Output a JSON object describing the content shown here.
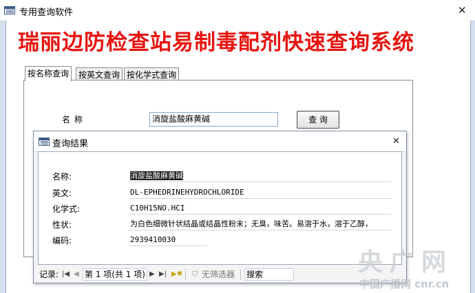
{
  "main_window": {
    "title": "专用查询软件",
    "close": "✕"
  },
  "banner": {
    "title": "瑞丽边防检查站易制毒配剂快速查询系统"
  },
  "tabs": [
    {
      "label": "按名称查询",
      "active": true
    },
    {
      "label": "按英文查询",
      "active": false
    },
    {
      "label": "按化学式查询",
      "active": false
    }
  ],
  "search": {
    "label": "名  称",
    "value": "消旋盐酸麻黄碱",
    "button": "查 询"
  },
  "dialog": {
    "title": "查询结果",
    "close": "✕",
    "fields": [
      {
        "label": "名称:",
        "value": "消旋盐酸麻黄碱"
      },
      {
        "label": "英文:",
        "value": "DL-EPHEDRINEHYDROCHLORIDE"
      },
      {
        "label": "化学式:",
        "value": "C10H15NO.HCI"
      },
      {
        "label": "性状:",
        "value": "为白色细微针状结晶或结晶性粉末；无臭，味苦。易溶于水，溶于乙醇，"
      },
      {
        "label": "编码:",
        "value": "2939410030"
      }
    ],
    "record_nav": {
      "label": "记录:",
      "position": "第 1 项(共 1 项)",
      "filter": "无筛选器",
      "search": "搜索"
    }
  },
  "watermark": {
    "big": "央广网",
    "small": "中国广播网 cnr.cn"
  }
}
